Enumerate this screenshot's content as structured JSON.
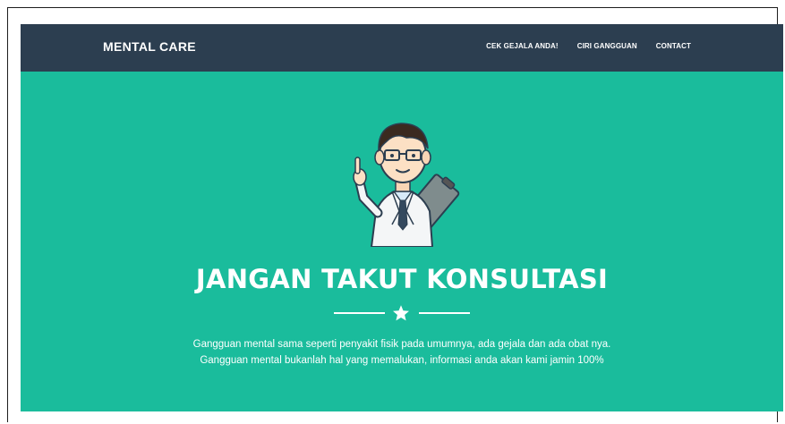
{
  "navbar": {
    "brand": "MENTAL CARE",
    "links": [
      "CEK GEJALA ANDA!",
      "CIRI GANGGUAN",
      "CONTACT"
    ]
  },
  "hero": {
    "illustration_icon": "doctor-illustration-icon",
    "title": "JANGAN TAKUT KONSULTASI",
    "divider_icon": "star-icon",
    "description_line1": "Gangguan mental sama seperti penyakit fisik pada umumnya, ada gejala dan ada obat nya.",
    "description_line2": "Gangguan mental bukanlah hal yang memalukan, informasi anda akan kami jamin 100%"
  },
  "colors": {
    "navbar_bg": "#2c3e50",
    "hero_bg": "#1abc9c",
    "text": "#ffffff"
  }
}
